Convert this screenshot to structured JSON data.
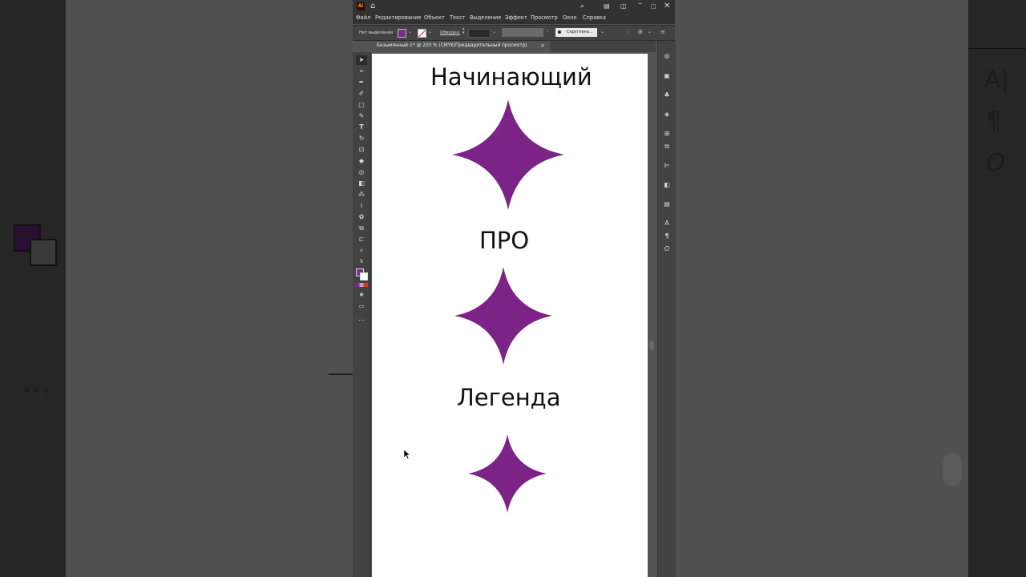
{
  "app": {
    "logo": "Ai",
    "menu": [
      "Файл",
      "Редактирование",
      "Объект",
      "Текст",
      "Выделение",
      "Эффект",
      "Просмотр",
      "Окно",
      "Справка"
    ]
  },
  "control_bar": {
    "selection_status": "Нет выделения",
    "stroke_label": "Обводка:",
    "stroke_style": "Скруглена..."
  },
  "document_tab": {
    "title": "Безымянный-1* @ 200 % (CMYK/Предварительный просмотр)",
    "close": "×"
  },
  "artboard": {
    "labels": [
      "Начинающий",
      "ПРО",
      "Легенда"
    ],
    "star_color": "#7b2386"
  },
  "colors": {
    "fill": "#7b2d8e",
    "stroke": "none"
  }
}
